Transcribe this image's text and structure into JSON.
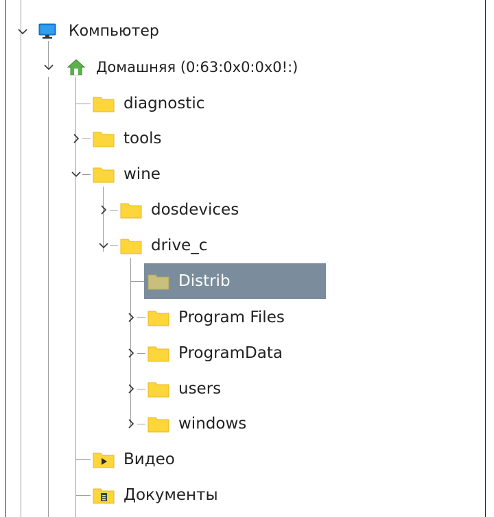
{
  "tree": {
    "items": [
      {
        "label": "Компьютер",
        "icon": "monitor-icon",
        "state": "expanded"
      },
      {
        "label": "Домашняя (0:63:0x0:0x0!:)",
        "icon": "home-icon",
        "state": "expanded"
      },
      {
        "label": "diagnostic",
        "icon": "folder-icon",
        "state": "leaf"
      },
      {
        "label": "tools",
        "icon": "folder-icon",
        "state": "collapsed"
      },
      {
        "label": "wine",
        "icon": "folder-icon",
        "state": "expanded"
      },
      {
        "label": "dosdevices",
        "icon": "folder-icon",
        "state": "collapsed"
      },
      {
        "label": "drive_c",
        "icon": "folder-icon",
        "state": "expanded"
      },
      {
        "label": "Distrib",
        "icon": "folder-icon",
        "state": "selected"
      },
      {
        "label": "Program Files",
        "icon": "folder-icon",
        "state": "collapsed"
      },
      {
        "label": "ProgramData",
        "icon": "folder-icon",
        "state": "collapsed"
      },
      {
        "label": "users",
        "icon": "folder-icon",
        "state": "collapsed"
      },
      {
        "label": "windows",
        "icon": "folder-icon",
        "state": "collapsed"
      },
      {
        "label": "Видео",
        "icon": "video-folder-icon",
        "state": "leaf"
      },
      {
        "label": "Документы",
        "icon": "documents-folder-icon",
        "state": "leaf"
      }
    ]
  },
  "colors": {
    "selection": "#7b8d9c",
    "folder": "#fcd63a",
    "home": "#5cb14a",
    "monitor": "#1e88e5"
  }
}
